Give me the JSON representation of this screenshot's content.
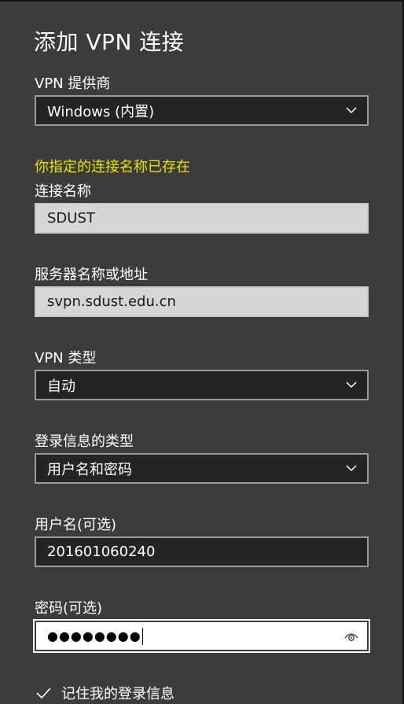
{
  "dialog": {
    "title": "添加 VPN 连接"
  },
  "vpn_provider": {
    "label": "VPN 提供商",
    "value": "Windows (内置)"
  },
  "warning": "你指定的连接名称已存在",
  "connection_name": {
    "label": "连接名称",
    "value": "SDUST"
  },
  "server": {
    "label": "服务器名称或地址",
    "value": "svpn.sdust.edu.cn"
  },
  "vpn_type": {
    "label": "VPN 类型",
    "value": "自动"
  },
  "signin_type": {
    "label": "登录信息的类型",
    "value": "用户名和密码"
  },
  "username": {
    "label": "用户名(可选)",
    "value": "201601060240"
  },
  "password": {
    "label": "密码(可选)",
    "masked": "●●●●●●●●"
  },
  "remember": {
    "label": "记住我的登录信息",
    "checked": true
  },
  "icons": {
    "dropdown": "chevron-down-icon",
    "reveal": "eye-icon",
    "check": "checkmark-icon"
  },
  "colors": {
    "background": "#3c3c3c",
    "warning": "#e8e000",
    "field_dark": "#242424",
    "field_disabled": "#d6d6d6"
  }
}
